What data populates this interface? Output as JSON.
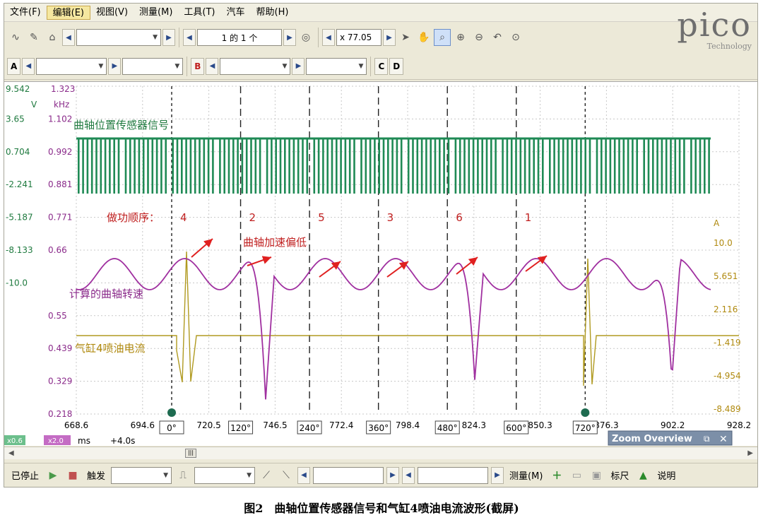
{
  "menu": [
    "文件(F)",
    "编辑(E)",
    "视图(V)",
    "测量(M)",
    "工具(T)",
    "汽车",
    "帮助(H)"
  ],
  "toolbar1": {
    "page_label": "1 的 1 个",
    "zoom_label": "x 77.05"
  },
  "toolbar2": {
    "channels": [
      "A",
      "B",
      "C",
      "D"
    ]
  },
  "logo": {
    "brand": "pico",
    "sub": "Technology"
  },
  "left_axis_top": {
    "v": "9.542",
    "khz": "1.323",
    "unit_v": "V",
    "unit_khz": "kHz"
  },
  "left_axis_ticks": [
    {
      "v": "",
      "khz": ""
    },
    {
      "v": "3.65",
      "khz": "1.102"
    },
    {
      "v": "0.704",
      "khz": "0.992"
    },
    {
      "v": "-2.241",
      "khz": "0.881"
    },
    {
      "v": "-5.187",
      "khz": "0.771"
    },
    {
      "v": "-8.133",
      "khz": "0.66"
    },
    {
      "v": "-10.0",
      "khz": ""
    },
    {
      "v": "",
      "khz": "0.55"
    },
    {
      "v": "",
      "khz": "0.439"
    },
    {
      "v": "",
      "khz": "0.329"
    },
    {
      "v": "",
      "khz": "0.218"
    }
  ],
  "right_axis": {
    "unit": "A",
    "ticks": [
      "10.0",
      "5.651",
      "2.116",
      "-1.419",
      "-4.954",
      "-8.489"
    ]
  },
  "x_ticks": [
    "668.6",
    "694.6",
    "720.5",
    "746.5",
    "772.4",
    "798.4",
    "824.3",
    "850.3",
    "876.3",
    "902.2",
    "928.2"
  ],
  "angle_markers": [
    "0°",
    "120°",
    "240°",
    "360°",
    "480°",
    "600°",
    "720°"
  ],
  "annotations": {
    "crank_signal": "曲轴位置传感器信号",
    "firing_order_label": "做功顺序：",
    "firing_order": [
      "4",
      "2",
      "5",
      "3",
      "6",
      "1"
    ],
    "accel_low": "曲轴加速偏低",
    "calc_speed": "计算的曲轴转速",
    "injector_current": "气缸4喷油电流"
  },
  "bottom_axis": {
    "scale_a": "x0.6",
    "scale_b": "x2.0",
    "unit": "ms",
    "offset": "+4.0s"
  },
  "zoom_overview": "Zoom Overview",
  "status": {
    "stopped": "已停止",
    "trigger": "触发",
    "measure": "测量(M)",
    "ruler": "标尺",
    "notes": "说明"
  },
  "caption": "图2　曲轴位置传感器信号和气缸4喷油电流波形(截屏)",
  "colors": {
    "crank": "#1f8a55",
    "speed": "#a030a0",
    "current": "#b09a20",
    "arrow": "#e02020",
    "label_green": "#1f7a3f",
    "label_purple": "#8a2a8a",
    "label_gold": "#b08a10"
  }
}
